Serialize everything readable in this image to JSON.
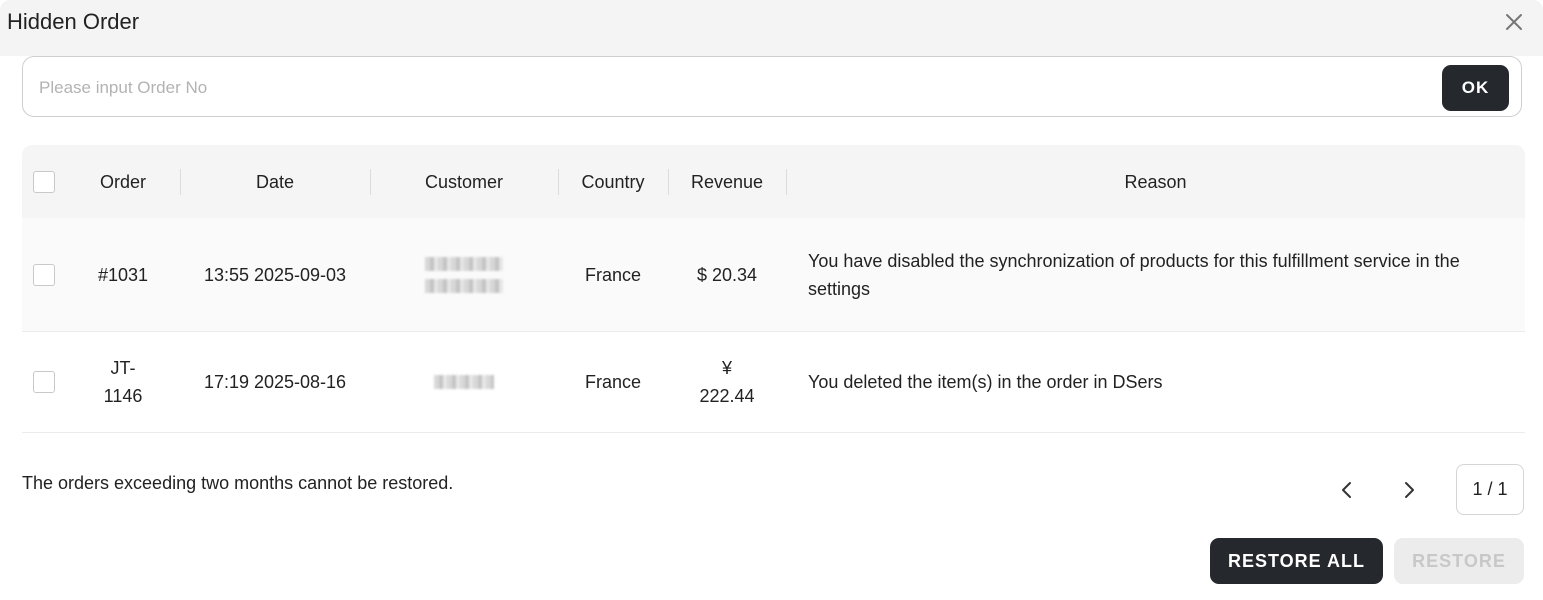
{
  "dialog": {
    "title": "Hidden Order",
    "close_icon": "close-icon"
  },
  "search": {
    "placeholder": "Please input Order No",
    "value": "",
    "ok_label": "OK"
  },
  "table": {
    "columns": [
      "Order",
      "Date",
      "Customer",
      "Country",
      "Revenue",
      "Reason"
    ],
    "rows": [
      {
        "order": "#1031",
        "date": "13:55 2025-09-03",
        "country": "France",
        "revenue": "$ 20.34",
        "reason": "You have disabled the synchronization of products for this fulfillment service in the settings"
      },
      {
        "order": "JT-1146",
        "date": "17:19 2025-08-16",
        "country": "France",
        "revenue": "¥ 222.44",
        "reason": "You deleted the item(s) in the order in DSers"
      }
    ]
  },
  "footer": {
    "note": "The orders exceeding two months cannot be restored.",
    "pagination": "1 / 1",
    "restore_all_label": "RESTORE ALL",
    "restore_label": "RESTORE"
  }
}
